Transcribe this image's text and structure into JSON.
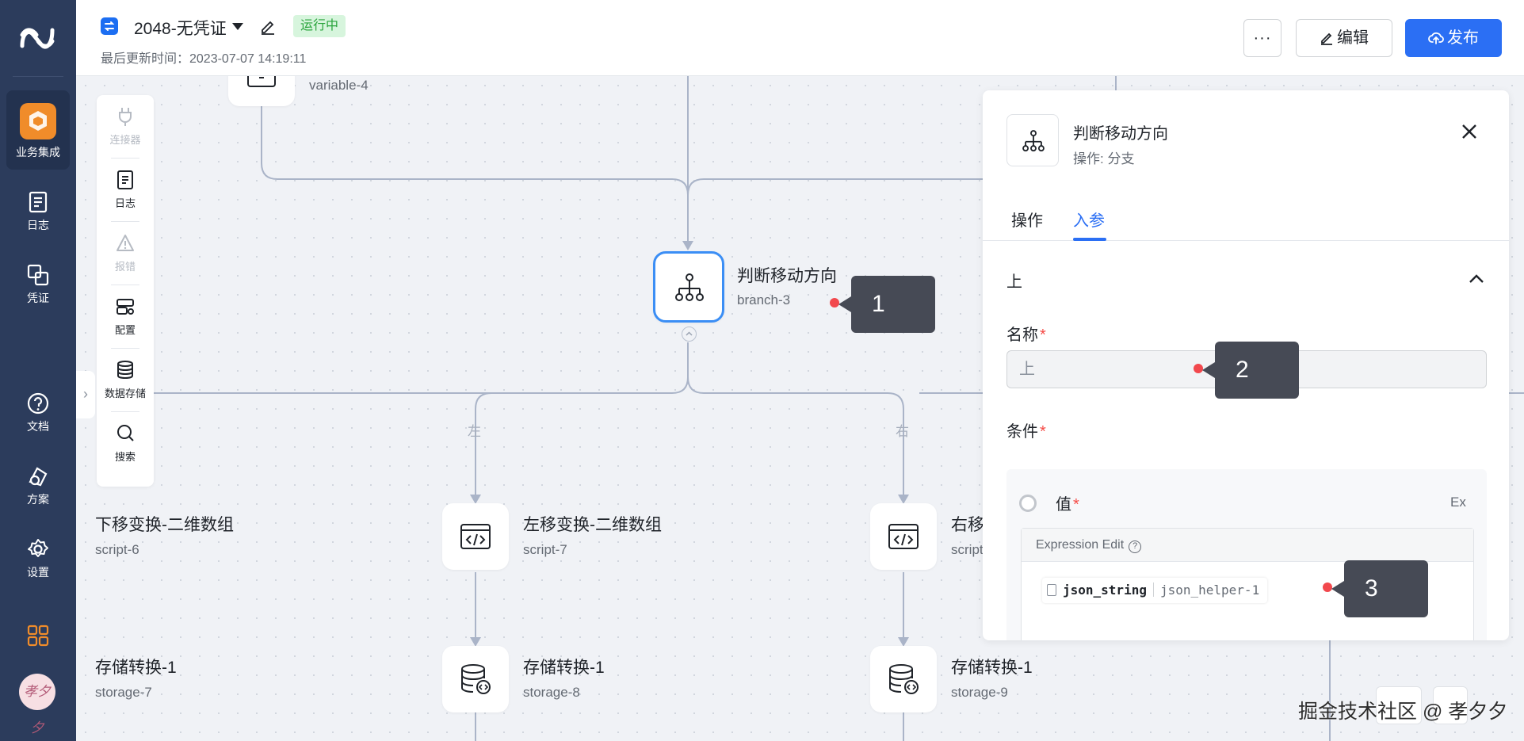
{
  "sidebar": {
    "items": [
      {
        "label": "业务集成",
        "icon": "cube-icon"
      },
      {
        "label": "日志",
        "icon": "log-icon"
      },
      {
        "label": "凭证",
        "icon": "credential-icon"
      },
      {
        "label": "文档",
        "icon": "help-icon"
      },
      {
        "label": "方案",
        "icon": "solution-icon"
      },
      {
        "label": "设置",
        "icon": "gear-icon"
      }
    ],
    "avatar_text": "孝夕夕"
  },
  "header": {
    "title": "2048-无凭证",
    "status": "运行中",
    "updated": "最后更新时间：2023-07-07 14:19:11",
    "more_label": "···",
    "edit_label": "编辑",
    "publish_label": "发布",
    "colors": {
      "accent": "#2b6ff4",
      "status_bg": "#d7f5dd",
      "status_fg": "#29a33b"
    }
  },
  "tools": [
    {
      "label": "连接器",
      "icon": "plug-icon",
      "disabled": true
    },
    {
      "label": "日志",
      "icon": "log-icon",
      "disabled": false
    },
    {
      "label": "报错",
      "icon": "warning-icon",
      "disabled": true
    },
    {
      "label": "配置",
      "icon": "config-icon",
      "disabled": false
    },
    {
      "label": "数据存储",
      "icon": "database-icon",
      "disabled": false
    },
    {
      "label": "搜索",
      "icon": "search-icon",
      "disabled": false
    }
  ],
  "canvas": {
    "nodes": {
      "top": {
        "sub": "variable-4"
      },
      "branch": {
        "title": "判断移动方向",
        "sub": "branch-3"
      },
      "down": {
        "title": "下移变换-二维数组",
        "sub": "script-6"
      },
      "left": {
        "title": "左移变换-二维数组",
        "sub": "script-7"
      },
      "right": {
        "title": "右移",
        "sub": "script"
      },
      "store1": {
        "title": "存储转换-1",
        "sub": "storage-7"
      },
      "store2": {
        "title": "存储转换-1",
        "sub": "storage-8"
      },
      "store3": {
        "title": "存储转换-1",
        "sub": "storage-9"
      }
    },
    "edge_labels": {
      "left": "左",
      "right": "右"
    }
  },
  "panel": {
    "title": "判断移动方向",
    "subtitle": "操作: 分支",
    "tabs": [
      {
        "label": "操作"
      },
      {
        "label": "入参"
      }
    ],
    "active_tab": "入参",
    "section_title": "上",
    "name_label": "名称",
    "name_value": "上",
    "condition_label": "条件",
    "value_label": "值",
    "ex_label": "Ex",
    "expression_header": "Expression Edit",
    "expression_chip": {
      "key": "json_string",
      "ref": "json_helper-1"
    }
  },
  "callouts": [
    "1",
    "2",
    "3"
  ],
  "watermark": "掘金技术社区 @ 孝夕夕"
}
